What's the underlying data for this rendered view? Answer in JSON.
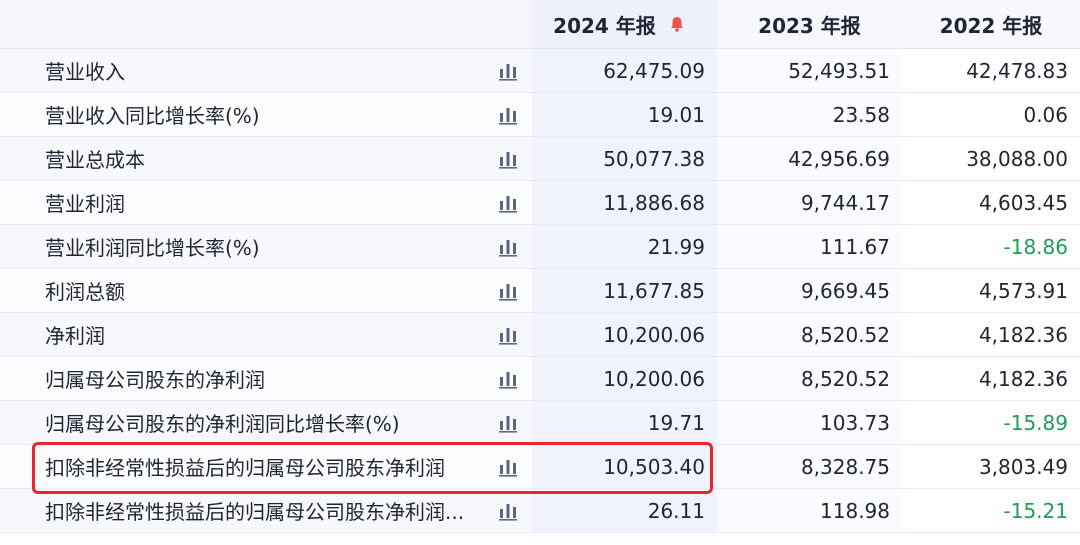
{
  "headers": [
    "",
    "2024 年报",
    "2023 年报",
    "2022 年报"
  ],
  "colors": {
    "negative": "#1f9d55",
    "highlight": "#e8262f",
    "bell": "#f04f4f"
  },
  "rows": [
    {
      "label": "营业收入",
      "v2024": "62,475.09",
      "v2023": "52,493.51",
      "v2022": "42,478.83"
    },
    {
      "label": "营业收入同比增长率(%)",
      "v2024": "19.01",
      "v2023": "23.58",
      "v2022": "0.06"
    },
    {
      "label": "营业总成本",
      "v2024": "50,077.38",
      "v2023": "42,956.69",
      "v2022": "38,088.00"
    },
    {
      "label": "营业利润",
      "v2024": "11,886.68",
      "v2023": "9,744.17",
      "v2022": "4,603.45"
    },
    {
      "label": "营业利润同比增长率(%)",
      "v2024": "21.99",
      "v2023": "111.67",
      "v2022": "-18.86"
    },
    {
      "label": "利润总额",
      "v2024": "11,677.85",
      "v2023": "9,669.45",
      "v2022": "4,573.91"
    },
    {
      "label": "净利润",
      "v2024": "10,200.06",
      "v2023": "8,520.52",
      "v2022": "4,182.36"
    },
    {
      "label": "归属母公司股东的净利润",
      "v2024": "10,200.06",
      "v2023": "8,520.52",
      "v2022": "4,182.36"
    },
    {
      "label": "归属母公司股东的净利润同比增长率(%)",
      "v2024": "19.71",
      "v2023": "103.73",
      "v2022": "-15.89"
    },
    {
      "label": "扣除非经常性损益后的归属母公司股东净利润",
      "v2024": "10,503.40",
      "v2023": "8,328.75",
      "v2022": "3,803.49"
    },
    {
      "label": "扣除非经常性损益后的归属母公司股东净利润...",
      "v2024": "26.11",
      "v2023": "118.98",
      "v2022": "-15.21"
    }
  ]
}
